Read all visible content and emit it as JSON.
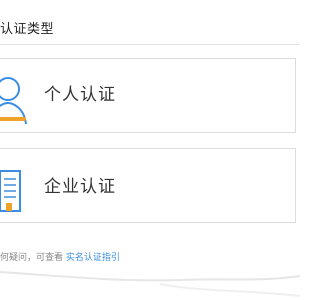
{
  "header": {
    "title": "认证类型"
  },
  "cards": [
    {
      "label": "个人认证",
      "icon": "person-icon"
    },
    {
      "label": "企业认证",
      "icon": "building-icon"
    }
  ],
  "footer": {
    "prefix": "何疑问，可查看",
    "link": "实名认证指引"
  },
  "colors": {
    "accent_blue": "#3a8de0",
    "icon_orange": "#f0a32a"
  }
}
